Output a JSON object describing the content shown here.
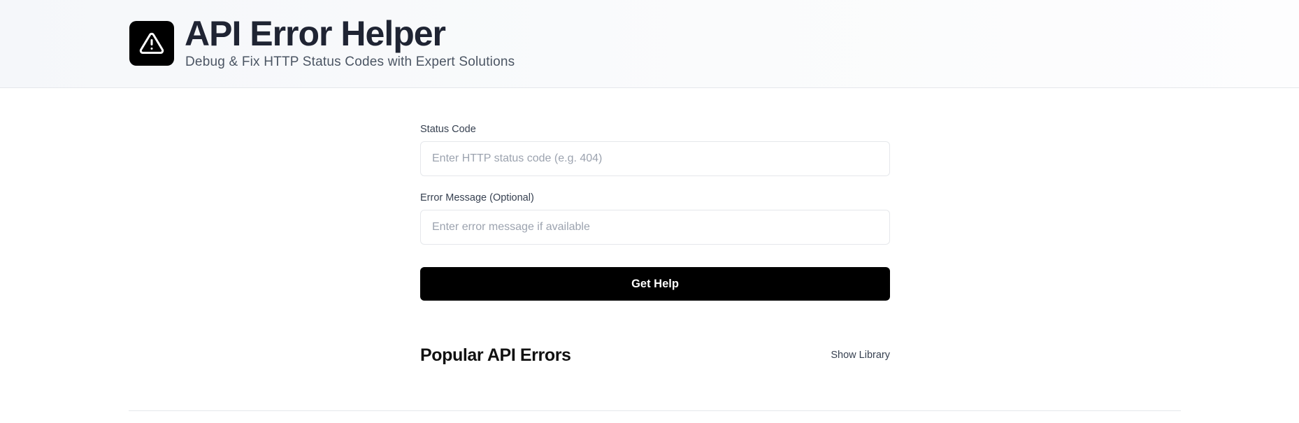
{
  "header": {
    "title": "API Error Helper",
    "subtitle": "Debug & Fix HTTP Status Codes with Expert Solutions",
    "logo_icon": "warning-triangle-icon"
  },
  "form": {
    "status_code": {
      "label": "Status Code",
      "placeholder": "Enter HTTP status code (e.g. 404)",
      "value": ""
    },
    "error_message": {
      "label": "Error Message (Optional)",
      "placeholder": "Enter error message if available",
      "value": ""
    },
    "submit_label": "Get Help"
  },
  "popular": {
    "title": "Popular API Errors",
    "show_library_label": "Show Library"
  },
  "colors": {
    "accent": "#000000",
    "title_text": "#1f2433",
    "border": "#e5e7eb"
  }
}
